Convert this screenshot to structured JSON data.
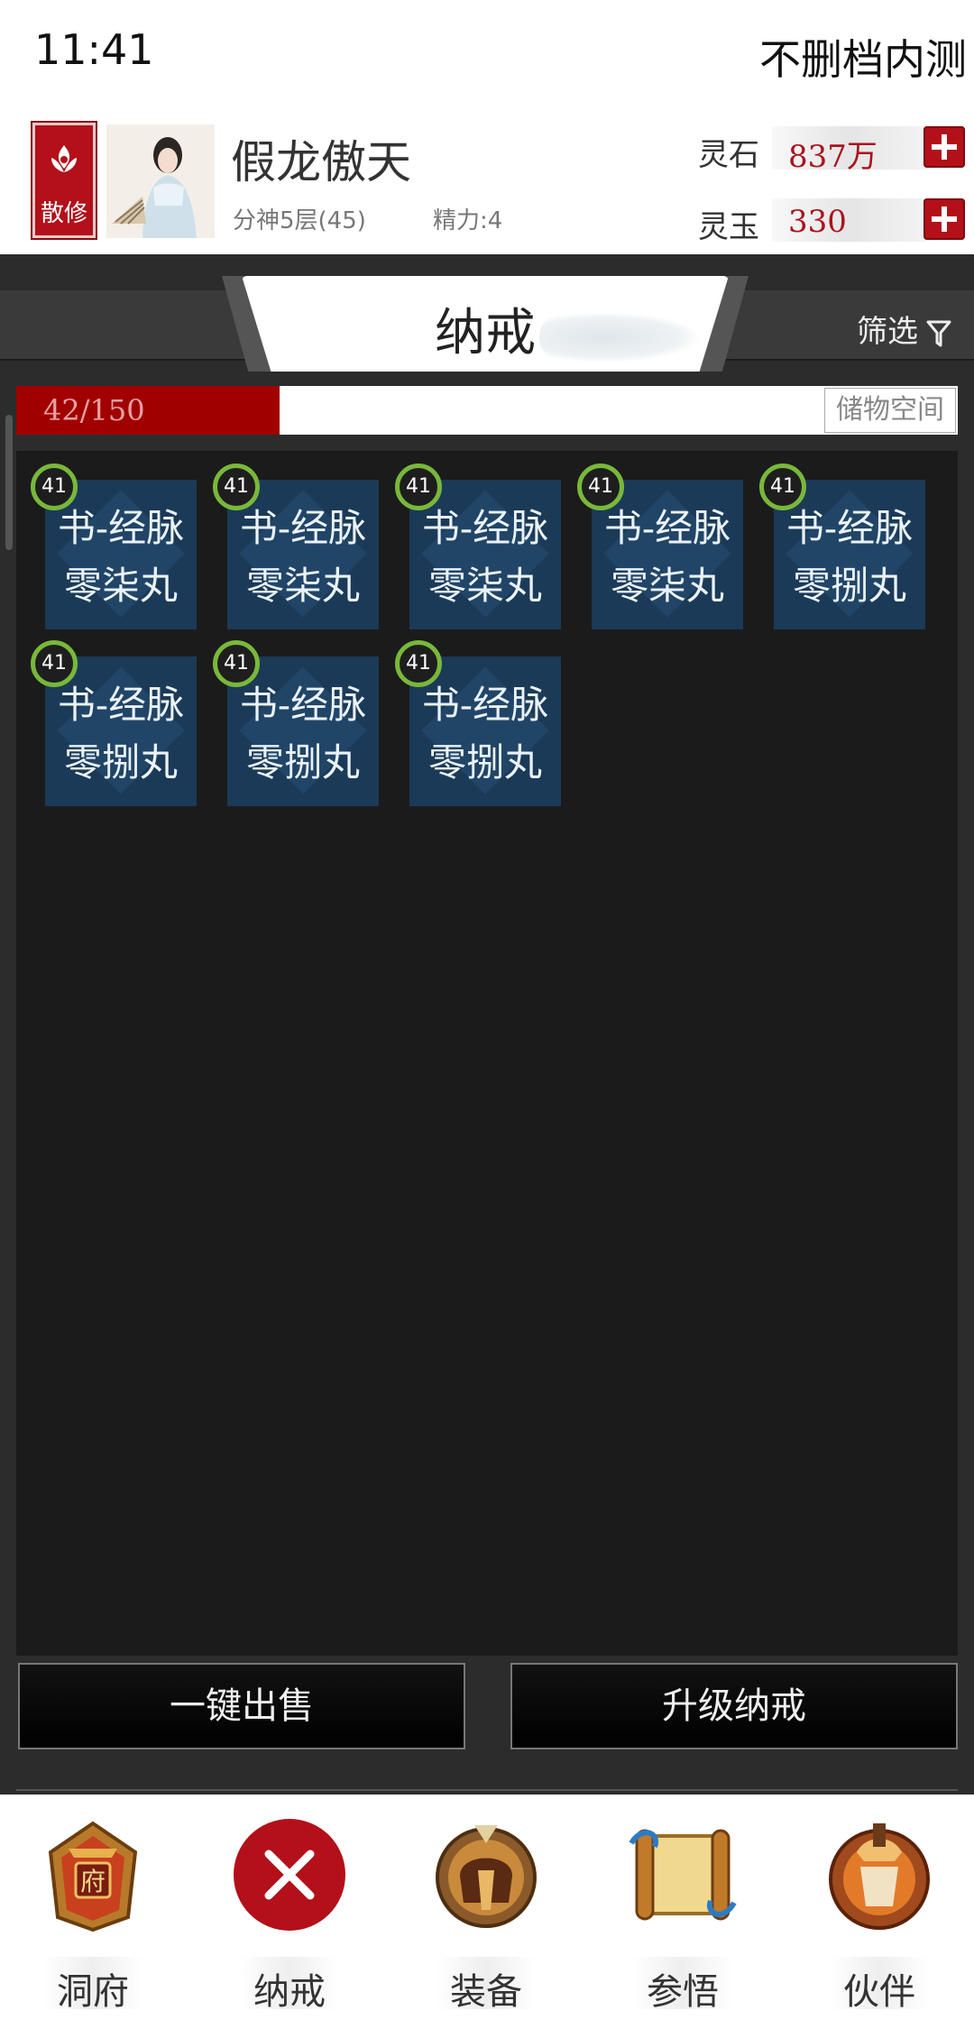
{
  "status": {
    "time": "11:41",
    "server": "不删档内测"
  },
  "player": {
    "sect_label": "散修",
    "name": "假龙傲天",
    "realm": "分神5层(45)",
    "energy": "精力:4"
  },
  "currency": [
    {
      "label": "灵石",
      "value": "837万"
    },
    {
      "label": "灵玉",
      "value": "330"
    }
  ],
  "panel": {
    "title": "纳戒",
    "filter_label": "筛选",
    "capacity_text": "42/150",
    "capacity_fraction": 0.28,
    "storage_label": "储物空间"
  },
  "items": [
    {
      "level": "41",
      "line1": "书-经脉",
      "line2": "零柒丸"
    },
    {
      "level": "41",
      "line1": "书-经脉",
      "line2": "零柒丸"
    },
    {
      "level": "41",
      "line1": "书-经脉",
      "line2": "零柒丸"
    },
    {
      "level": "41",
      "line1": "书-经脉",
      "line2": "零柒丸"
    },
    {
      "level": "41",
      "line1": "书-经脉",
      "line2": "零捌丸"
    },
    {
      "level": "41",
      "line1": "书-经脉",
      "line2": "零捌丸"
    },
    {
      "level": "41",
      "line1": "书-经脉",
      "line2": "零捌丸"
    },
    {
      "level": "41",
      "line1": "书-经脉",
      "line2": "零捌丸"
    }
  ],
  "actions": {
    "sell_all": "一键出售",
    "upgrade": "升级纳戒"
  },
  "nav": [
    {
      "label": "洞府",
      "icon": "mansion-icon",
      "emblem": "府"
    },
    {
      "label": "纳戒",
      "icon": "close-icon"
    },
    {
      "label": "装备",
      "icon": "helmet-icon"
    },
    {
      "label": "参悟",
      "icon": "scroll-icon"
    },
    {
      "label": "伙伴",
      "icon": "companion-icon"
    }
  ],
  "colors": {
    "accent_red": "#b3101a",
    "item_bg": "#1b3a57",
    "level_ring": "#78b83a"
  }
}
